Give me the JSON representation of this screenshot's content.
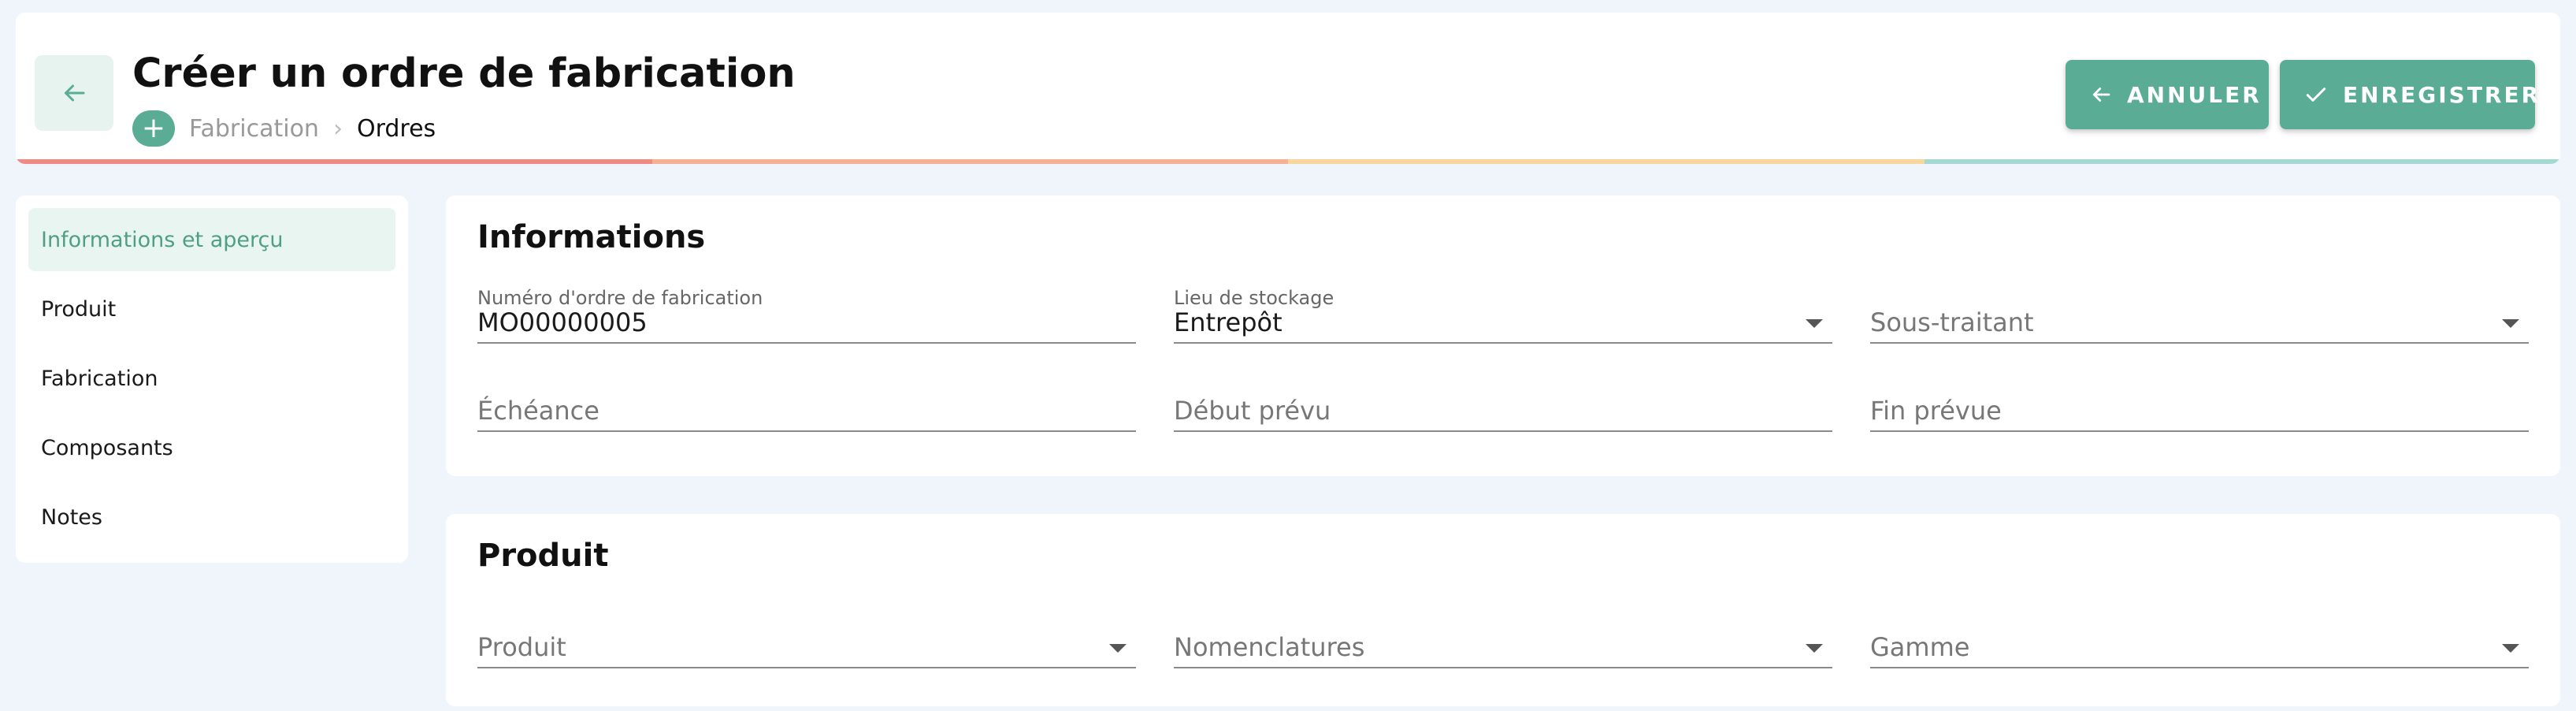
{
  "header": {
    "title": "Créer un ordre de fabrication",
    "breadcrumb": {
      "plus": "+",
      "parent": "Fabrication",
      "separator": "›",
      "current": "Ordres"
    },
    "buttons": {
      "cancel_label": "ANNULER",
      "save_label": "ENREGISTRER"
    },
    "accent_colors": [
      "#ef8a84",
      "#f4b196",
      "#f7d79e",
      "#a6d8d2"
    ]
  },
  "colors": {
    "primary": "#5aad94",
    "active_bg": "#e9f5f0",
    "active_text": "#4f9e86",
    "page_bg": "#f0f4fb"
  },
  "sidebar": {
    "items": [
      {
        "label": "Informations et aperçu",
        "active": true
      },
      {
        "label": "Produit",
        "active": false
      },
      {
        "label": "Fabrication",
        "active": false
      },
      {
        "label": "Composants",
        "active": false
      },
      {
        "label": "Notes",
        "active": false
      }
    ]
  },
  "informations": {
    "title": "Informations",
    "fields": {
      "numero": {
        "label": "Numéro d'ordre de fabrication",
        "value": "MO00000005"
      },
      "lieu": {
        "label": "Lieu de stockage",
        "value": "Entrepôt"
      },
      "sous_traitant": {
        "placeholder": "Sous-traitant"
      },
      "echeance": {
        "placeholder": "Échéance"
      },
      "debut": {
        "placeholder": "Début prévu"
      },
      "fin": {
        "placeholder": "Fin prévue"
      }
    }
  },
  "produit": {
    "title": "Produit",
    "fields": {
      "produit": {
        "placeholder": "Produit"
      },
      "nomenclatures": {
        "placeholder": "Nomenclatures"
      },
      "gamme": {
        "placeholder": "Gamme"
      }
    }
  },
  "icons": {
    "back": "arrow-left-icon",
    "cancel": "arrow-left-icon",
    "save": "check-icon",
    "dropdown": "caret-down-icon",
    "breadcrumb_add": "plus-icon"
  }
}
